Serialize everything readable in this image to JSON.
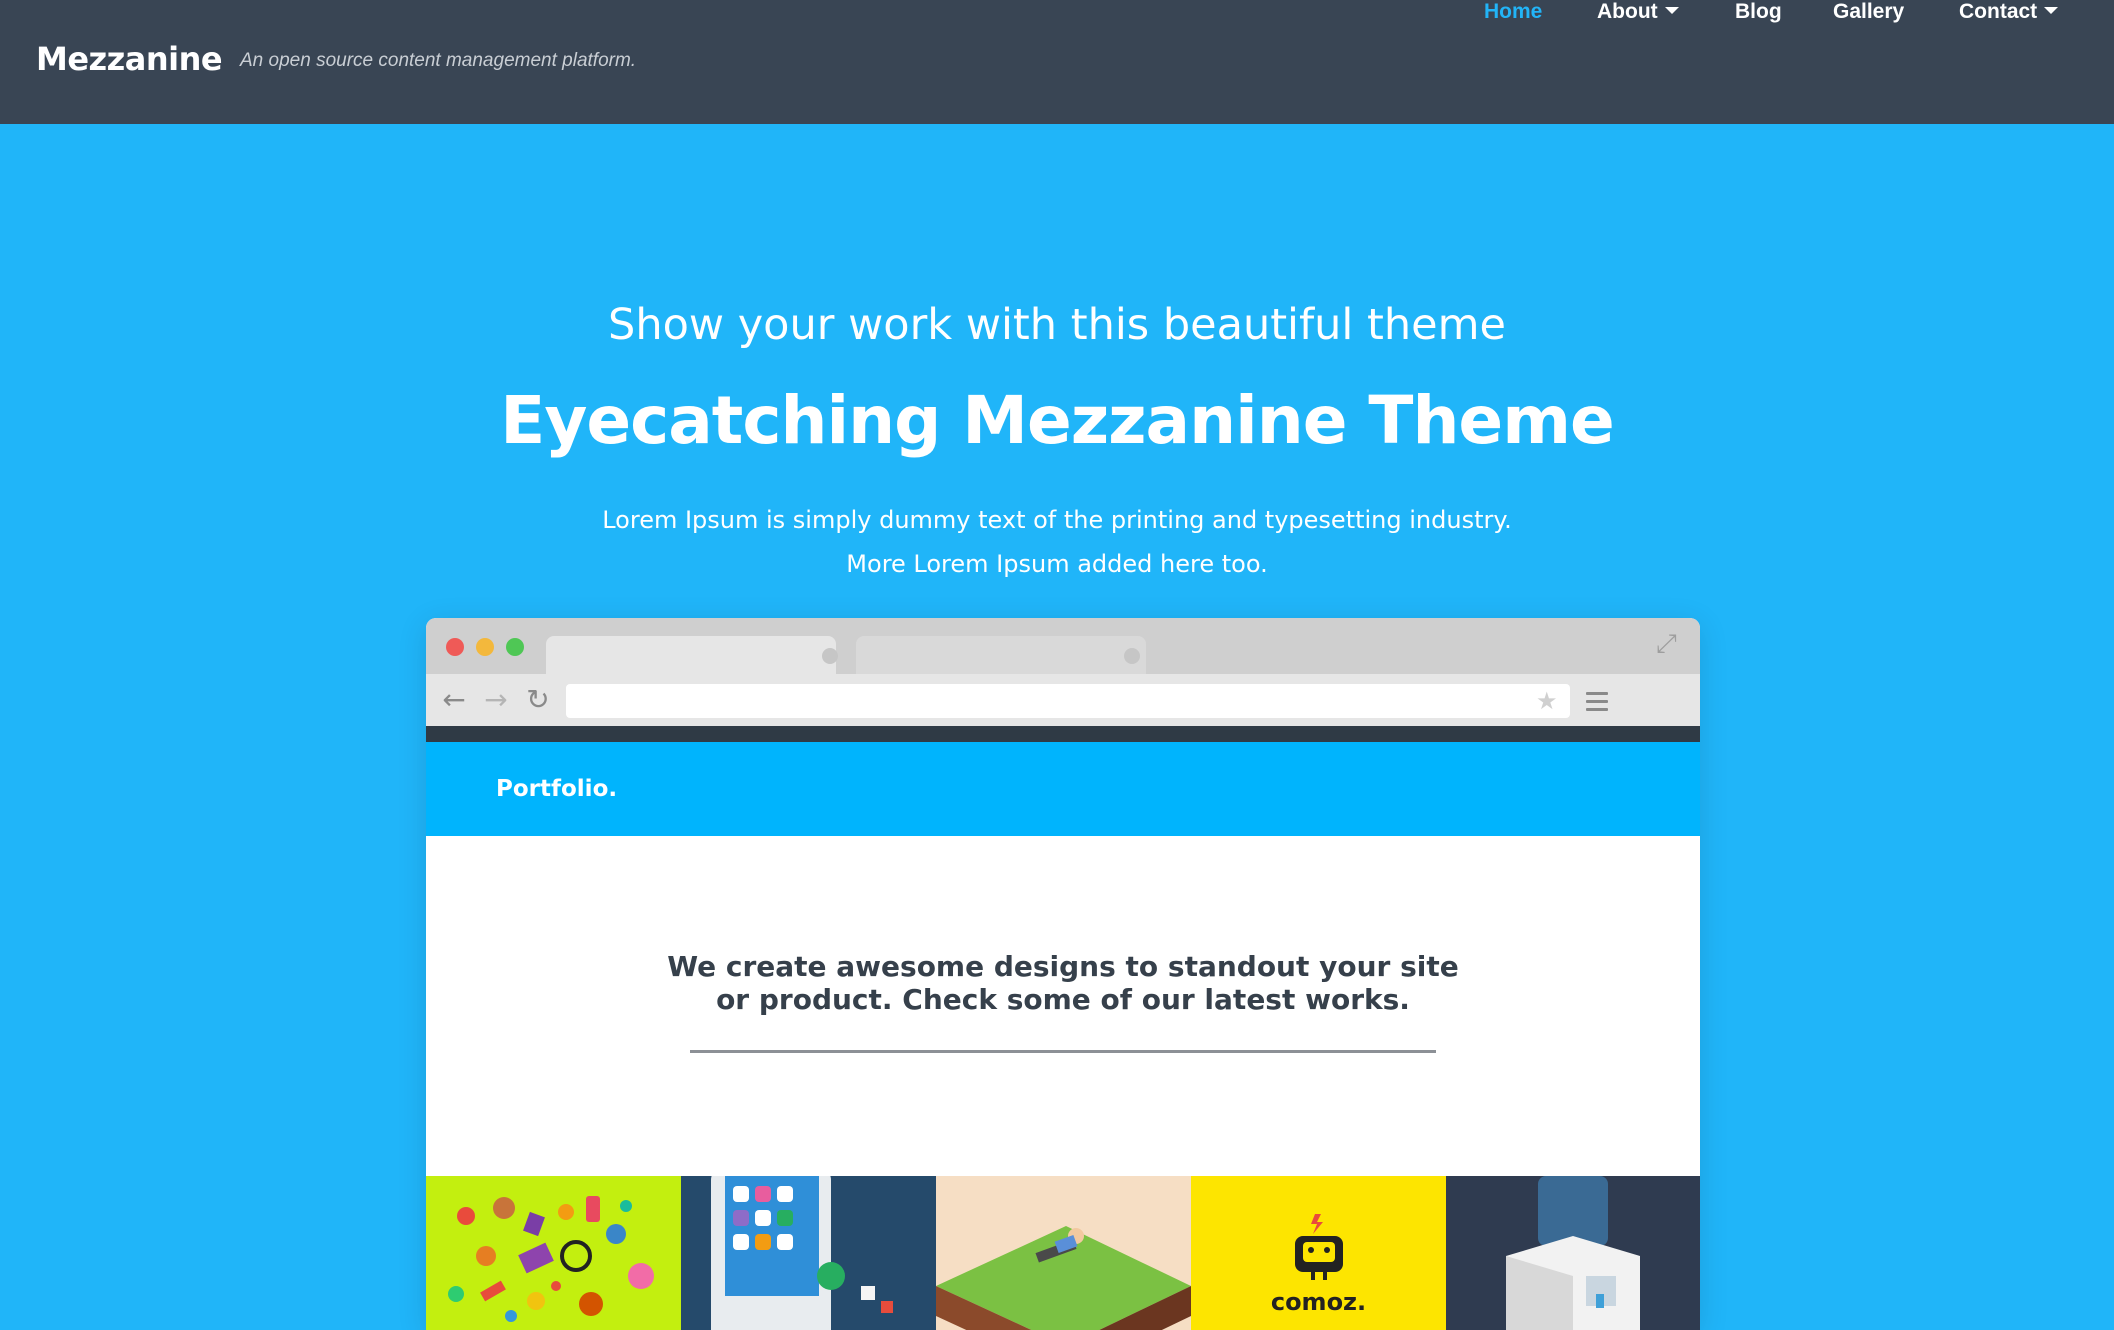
{
  "header": {
    "brand": "Mezzanine",
    "tagline": "An open source content management platform.",
    "nav": [
      {
        "label": "Home",
        "active": true,
        "dropdown": false
      },
      {
        "label": "About",
        "active": false,
        "dropdown": true
      },
      {
        "label": "Blog",
        "active": false,
        "dropdown": false
      },
      {
        "label": "Gallery",
        "active": false,
        "dropdown": false
      },
      {
        "label": "Contact",
        "active": false,
        "dropdown": true
      }
    ]
  },
  "hero": {
    "subtitle": "Show your work with this beautiful theme",
    "title": "Eyecatching Mezzanine Theme",
    "text_line1": "Lorem Ipsum is simply dummy text of the printing and typesetting industry.",
    "text_line2": "More Lorem Ipsum added here too."
  },
  "mockup": {
    "logo": "Portfolio.",
    "headline_line1": "We create awesome designs to standout your site",
    "headline_line2": "or product. Check some of our latest works.",
    "tile_label": "comoz."
  },
  "colors": {
    "navbar": "#394554",
    "hero_bg": "#20b5f9",
    "active_link": "#22b4f7",
    "mockup_header": "#00b4fd"
  }
}
